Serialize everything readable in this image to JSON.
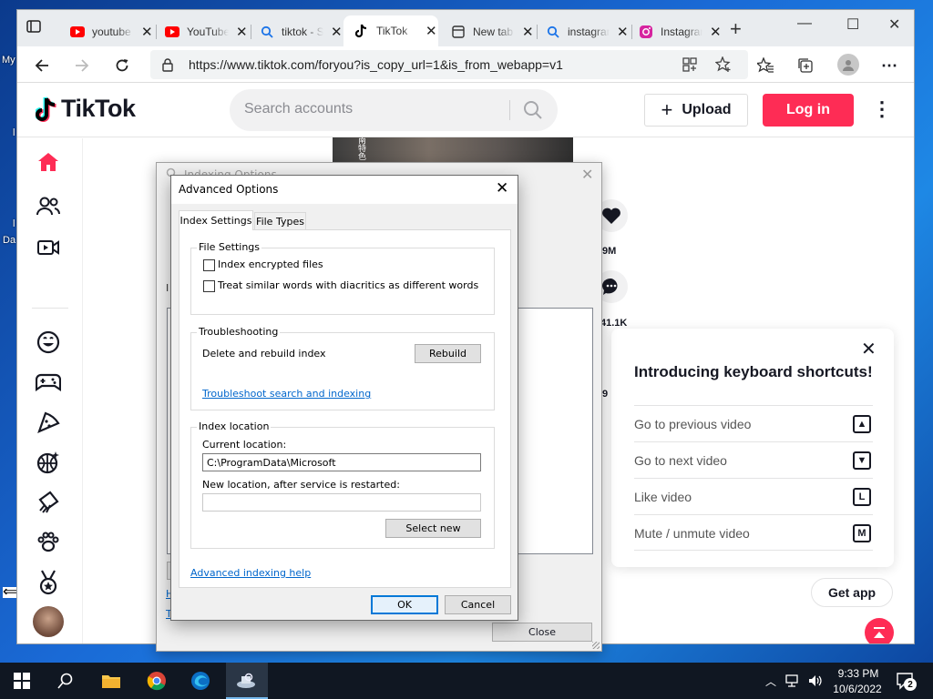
{
  "desktop": {
    "frag_my": "My",
    "frag_da": "Da",
    "frag_l1": "l",
    "frag_l2": "l"
  },
  "browser": {
    "tabs": [
      {
        "title": "youtube",
        "icon": "youtube-icon",
        "close": "✕"
      },
      {
        "title": "YouTube",
        "icon": "youtube-icon",
        "close": "✕"
      },
      {
        "title": "tiktok - Search",
        "icon": "search-icon",
        "close": "✕"
      },
      {
        "title": "TikTok",
        "icon": "tiktok-icon",
        "close": "✕"
      },
      {
        "title": "New tab",
        "icon": "newtab-icon",
        "close": "✕"
      },
      {
        "title": "instagram",
        "icon": "search-icon",
        "close": "✕"
      },
      {
        "title": "Instagram",
        "icon": "instagram-icon",
        "close": "✕"
      }
    ],
    "new_tab_symbol": "+",
    "url": "https://www.tiktok.com/foryou?is_copy_url=1&is_from_webapp=v1",
    "window_controls": {
      "minimize": "—",
      "maximize": "☐",
      "close": "✕"
    }
  },
  "tiktok": {
    "logo_text": "TikTok",
    "search_placeholder": "Search accounts",
    "upload_label": "Upload",
    "login_label": "Log in",
    "more_symbol": "⋮",
    "video_caption_chars": [
      "南",
      "特",
      "色"
    ],
    "actions": [
      {
        "icon": "heart-icon",
        "count": "9M"
      },
      {
        "icon": "comment-icon",
        "count": "41.1K"
      },
      {
        "icon": "share-icon",
        "count": "9"
      }
    ],
    "shortcuts": {
      "title": "Introducing keyboard shortcuts!",
      "close": "✕",
      "rows": [
        {
          "label": "Go to previous video",
          "key": "▲"
        },
        {
          "label": "Go to next video",
          "key": "▼"
        },
        {
          "label": "Like video",
          "key": "L"
        },
        {
          "label": "Mute / unmute video",
          "key": "M"
        }
      ]
    },
    "get_app_label": "Get app"
  },
  "indexing_window": {
    "title": "Indexing Options",
    "close": "✕",
    "close_button": "Close",
    "frag_i": "I",
    "frag_h": "H",
    "frag_t": "T"
  },
  "advanced_options": {
    "title": "Advanced Options",
    "close": "✕",
    "tabs": [
      "Index Settings",
      "File Types"
    ],
    "file_settings": {
      "legend": "File Settings",
      "checkbox1": "Index encrypted files",
      "checkbox1_checked": false,
      "checkbox2": "Treat similar words with diacritics as different words",
      "checkbox2_checked": false
    },
    "troubleshooting": {
      "legend": "Troubleshooting",
      "delete_rebuild": "Delete and rebuild index",
      "rebuild_button": "Rebuild",
      "troubleshoot_link": "Troubleshoot search and indexing"
    },
    "index_location": {
      "legend": "Index location",
      "current_label": "Current location:",
      "current_value": "C:\\ProgramData\\Microsoft",
      "new_label": "New location, after service is restarted:",
      "new_value": "",
      "select_new_button": "Select new"
    },
    "help_link": "Advanced indexing help",
    "ok_button": "OK",
    "cancel_button": "Cancel"
  },
  "taskbar": {
    "time": "9:33 PM",
    "date": "10/6/2022",
    "notification_count": "2"
  },
  "colors": {
    "tiktok_red": "#fe2c55",
    "tiktok_cyan": "#25f4ee",
    "link_blue": "#0066cc",
    "taskbar_bg": "#101722"
  }
}
